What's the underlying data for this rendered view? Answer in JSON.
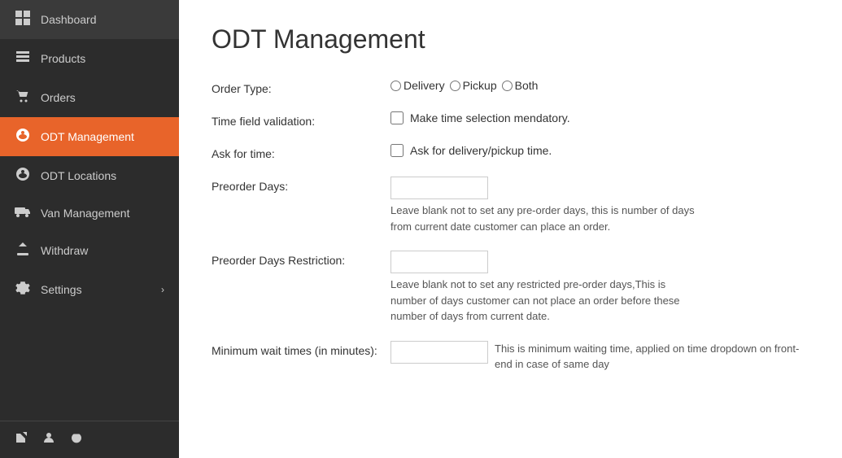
{
  "sidebar": {
    "items": [
      {
        "id": "dashboard",
        "label": "Dashboard",
        "icon": "⊞",
        "active": false
      },
      {
        "id": "products",
        "label": "Products",
        "icon": "≡",
        "active": false
      },
      {
        "id": "orders",
        "label": "Orders",
        "icon": "🛒",
        "active": false
      },
      {
        "id": "odt-management",
        "label": "ODT Management",
        "icon": "⚙",
        "active": true
      },
      {
        "id": "odt-locations",
        "label": "ODT Locations",
        "icon": "⚙",
        "active": false
      },
      {
        "id": "van-management",
        "label": "Van Management",
        "icon": "🚌",
        "active": false
      },
      {
        "id": "withdraw",
        "label": "Withdraw",
        "icon": "⬆",
        "active": false
      },
      {
        "id": "settings",
        "label": "Settings",
        "icon": "⚙",
        "active": false,
        "hasChevron": true
      }
    ],
    "bottom_icons": [
      {
        "id": "external",
        "icon": "↗"
      },
      {
        "id": "user",
        "icon": "👤"
      },
      {
        "id": "power",
        "icon": "⏻"
      }
    ]
  },
  "page": {
    "title": "ODT Management",
    "form": {
      "order_type": {
        "label": "Order Type:",
        "options": [
          "Delivery",
          "Pickup",
          "Both"
        ]
      },
      "time_field_validation": {
        "label": "Time field validation:",
        "checkbox_label": "Make time selection mendatory."
      },
      "ask_for_time": {
        "label": "Ask for time:",
        "checkbox_label": "Ask for delivery/pickup time."
      },
      "preorder_days": {
        "label": "Preorder Days:",
        "value": "",
        "help": "Leave blank not to set any pre-order days, this is number of days from current date customer can place an order."
      },
      "preorder_days_restriction": {
        "label": "Preorder Days Restriction:",
        "value": "",
        "help": "Leave blank not to set any restricted pre-order days,This is number of days customer can not place an order before these number of days from current date."
      },
      "minimum_wait_times": {
        "label": "Minimum wait times (in minutes):",
        "value": "",
        "help": "This is minimum waiting time, applied on time dropdown on front-end in case of same day"
      }
    }
  }
}
